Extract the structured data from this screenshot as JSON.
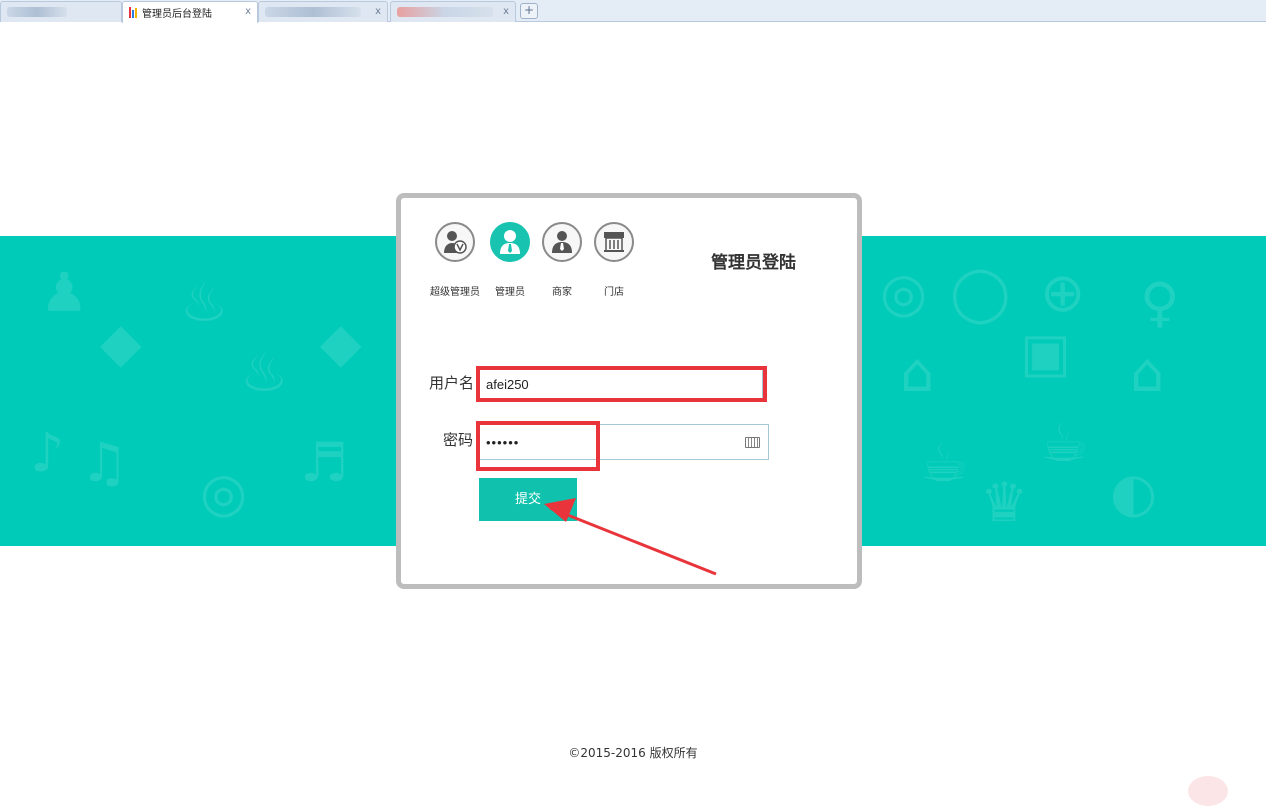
{
  "browser": {
    "tabs": [
      {
        "title": "",
        "active": false
      },
      {
        "title": "管理员后台登陆",
        "active": true,
        "close": "x"
      },
      {
        "title": "",
        "active": false,
        "close": "x"
      },
      {
        "title": "",
        "active": false,
        "close": "x"
      }
    ],
    "new_tab": "+"
  },
  "login": {
    "title": "管理员登陆",
    "roles": [
      {
        "label": "超级管理员",
        "icon": "super-admin-icon",
        "active": false
      },
      {
        "label": "管理员",
        "icon": "admin-user-icon",
        "active": true
      },
      {
        "label": "商家",
        "icon": "merchant-icon",
        "active": false
      },
      {
        "label": "门店",
        "icon": "store-icon",
        "active": false
      }
    ],
    "username_label": "用户名",
    "username_value": "afei250",
    "password_label": "密码",
    "password_value": "••••••",
    "submit_label": "提交"
  },
  "footer": {
    "copyright": "©2015-2016 版权所有"
  },
  "colors": {
    "accent": "#00cbb8",
    "highlight": "#e8343a"
  }
}
